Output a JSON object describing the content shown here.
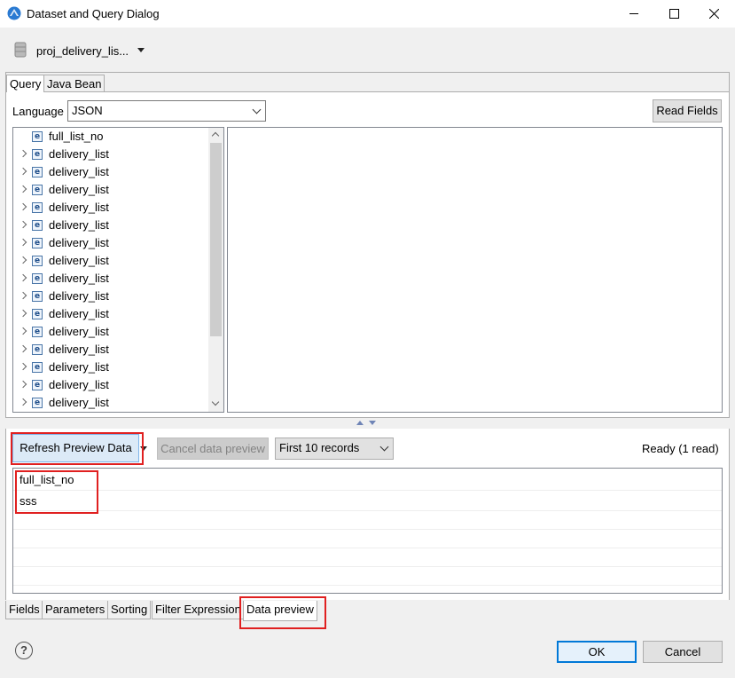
{
  "window": {
    "title": "Dataset and Query Dialog",
    "icon": "eclipse-birt-icon"
  },
  "data_source": {
    "label": "proj_delivery_lis..."
  },
  "top_tabs": [
    {
      "label": "Query",
      "selected": true
    },
    {
      "label": "Java Bean",
      "selected": false
    }
  ],
  "query": {
    "language_label": "Language",
    "language_value": "JSON",
    "read_fields_label": "Read Fields",
    "tree_items": [
      {
        "label": "full_list_no",
        "expandable": false
      },
      {
        "label": "delivery_list",
        "expandable": true
      },
      {
        "label": "delivery_list",
        "expandable": true
      },
      {
        "label": "delivery_list",
        "expandable": true
      },
      {
        "label": "delivery_list",
        "expandable": true
      },
      {
        "label": "delivery_list",
        "expandable": true
      },
      {
        "label": "delivery_list",
        "expandable": true
      },
      {
        "label": "delivery_list",
        "expandable": true
      },
      {
        "label": "delivery_list",
        "expandable": true
      },
      {
        "label": "delivery_list",
        "expandable": true
      },
      {
        "label": "delivery_list",
        "expandable": true
      },
      {
        "label": "delivery_list",
        "expandable": true
      },
      {
        "label": "delivery_list",
        "expandable": true
      },
      {
        "label": "delivery_list",
        "expandable": true
      },
      {
        "label": "delivery_list",
        "expandable": true
      },
      {
        "label": "delivery_list",
        "expandable": true
      }
    ],
    "tree_icon_glyph": "e"
  },
  "preview": {
    "refresh_label": "Refresh Preview Data",
    "cancel_label": "Cancel data preview",
    "records_value": "First 10 records",
    "status": "Ready (1 read)",
    "column_header": "full_list_no",
    "rows": [
      "sss"
    ]
  },
  "bottom_tabs": [
    {
      "label": "Fields",
      "selected": false
    },
    {
      "label": "Parameters",
      "selected": false
    },
    {
      "label": "Sorting",
      "selected": false
    },
    {
      "label": "Filter Expression",
      "selected": false
    },
    {
      "label": "Data preview",
      "selected": true
    }
  ],
  "footer": {
    "help_glyph": "?",
    "ok_label": "OK",
    "cancel_label": "Cancel"
  },
  "colors": {
    "highlight": "#e02020",
    "accent": "#0078d7"
  }
}
